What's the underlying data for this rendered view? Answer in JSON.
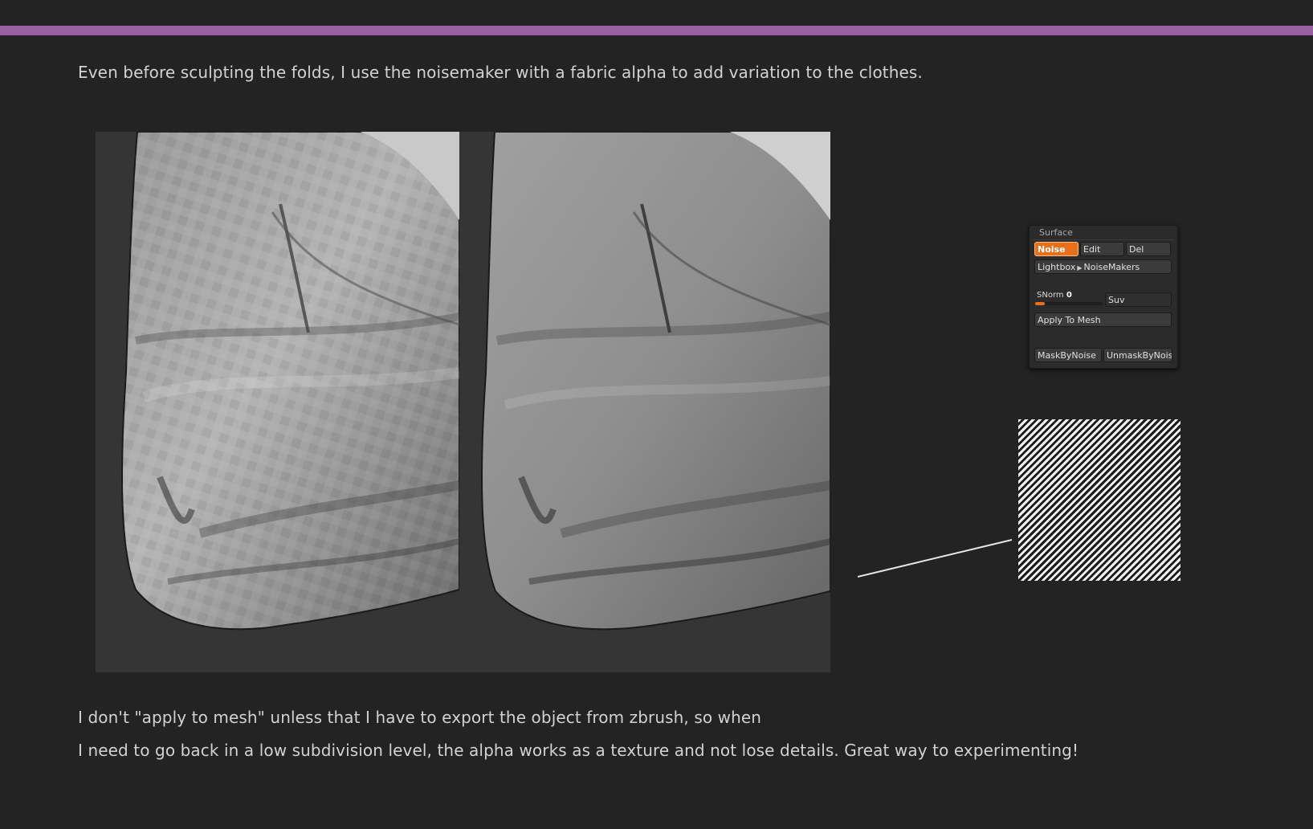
{
  "intro_text": "Even before sculpting the folds, I use the noisemaker with a fabric alpha to add variation to the clothes.",
  "body_line_1": "I don't \"apply to mesh\" unless that  I have to export the object from zbrush, so when",
  "body_line_2": "I need to go back in a low subdivision level, the alpha works as a texture and not lose details. Great way to experimenting!",
  "colors": {
    "accent": "#9a5fa0",
    "background": "#232323",
    "active_button": "#e8701a"
  },
  "zbrush_panel": {
    "title": "Surface",
    "buttons": {
      "noise": "Noise",
      "edit": "Edit",
      "del": "Del",
      "lightbox": "Lightbox",
      "noisemakers": "NoiseMakers",
      "suv": "Suv",
      "apply_to_mesh": "Apply To Mesh",
      "mask_by_noise": "MaskByNoise",
      "unmask_by_noise": "UnmaskByNois"
    },
    "snorm": {
      "label": "SNorm",
      "value": "0"
    }
  },
  "images": {
    "left_render": "sculpted-cloth-before-noise",
    "right_render": "sculpted-cloth-with-fabric-noise",
    "alpha": "fabric-weave-alpha"
  }
}
